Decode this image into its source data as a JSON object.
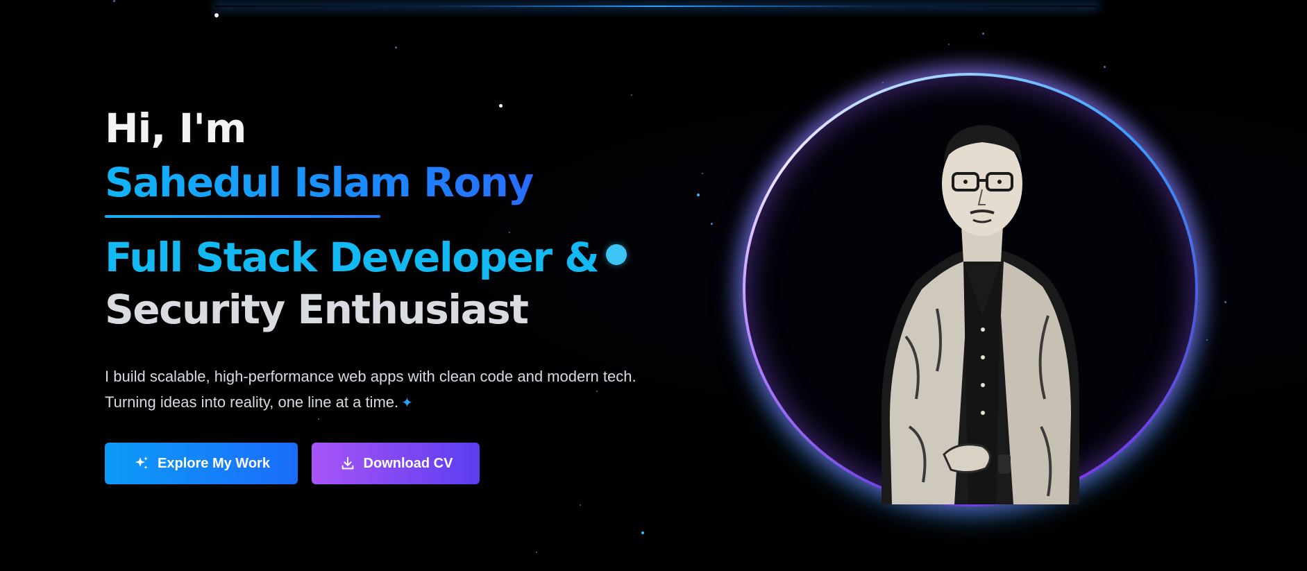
{
  "hero": {
    "greeting": "Hi, I'm",
    "name": "Sahedul Islam Rony",
    "title_line1": "Full Stack Developer &",
    "title_line2": "Security Enthusiast",
    "tagline_line1": "I build scalable, high-performance web apps with clean code and modern tech.",
    "tagline_line2": "Turning ideas into reality, one line at a time.",
    "buttons": {
      "explore": "Explore My Work",
      "download": "Download CV"
    }
  },
  "icons": {
    "tagline_sparkle": "sparkle-icon",
    "explore": "sparkles-icon",
    "download": "download-icon"
  },
  "colors": {
    "background": "#000000",
    "name_gradient_start": "#11b4f5",
    "name_gradient_end": "#2a6cff",
    "title_accent": "#13b9f2",
    "explore_button_start": "#0d9bf7",
    "explore_button_end": "#1a6cfb",
    "download_button_start": "#a855f7",
    "download_button_end": "#5b3df0",
    "ring_purple": "#9b6bff",
    "ring_blue": "#3c9dff"
  }
}
